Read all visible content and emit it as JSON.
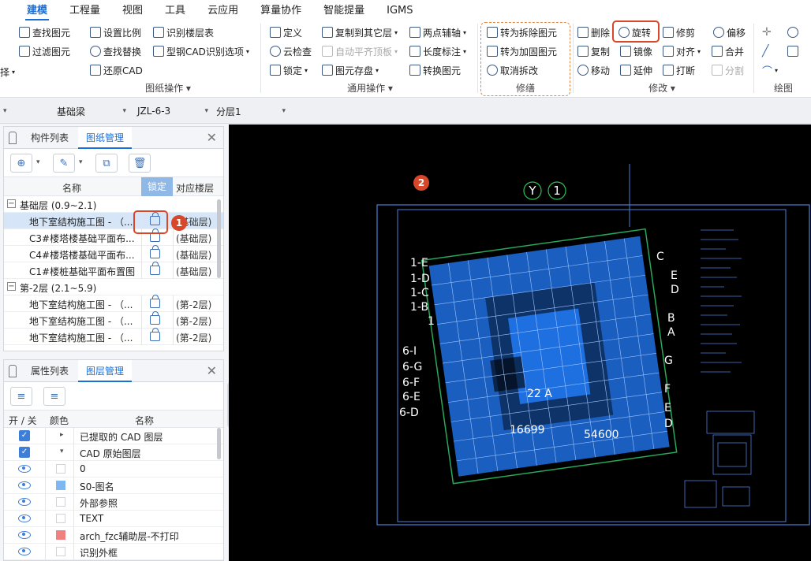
{
  "menu": {
    "tabs": [
      "建模",
      "工程量",
      "视图",
      "工具",
      "云应用",
      "算量协作",
      "智能提量",
      "IGMS"
    ],
    "active": "建模"
  },
  "ribbon": {
    "drawing_ops": {
      "title": "图纸操作",
      "buttons": [
        "查找图元",
        "过滤图元",
        "设置比例",
        "查找替换",
        "还原CAD",
        "识别楼层表",
        "型钢CAD识别选项"
      ],
      "left_cut_label": "择"
    },
    "common_ops": {
      "title": "通用操作",
      "buttons": [
        "定义",
        "云检查",
        "锁定",
        "复制到其它层",
        "自动平齐顶板",
        "图元存盘",
        "两点辅轴",
        "长度标注",
        "转换图元"
      ]
    },
    "repair": {
      "title": "修缮",
      "buttons": [
        "转为拆除图元",
        "转为加固图元",
        "取消拆改"
      ]
    },
    "modify": {
      "title": "修改",
      "buttons": [
        "删除",
        "旋转",
        "修剪",
        "偏移",
        "复制",
        "镜像",
        "对齐",
        "合并",
        "移动",
        "延伸",
        "打断",
        "分割"
      ]
    },
    "draw": {
      "title": "绘图"
    }
  },
  "toolbar2": {
    "component_type": "基础梁",
    "component_name": "JZL-6-3",
    "layer": "分层1"
  },
  "drawing_panel": {
    "tabs": [
      "构件列表",
      "图纸管理"
    ],
    "active_tab": "图纸管理",
    "columns": {
      "name": "名称",
      "lock": "锁定",
      "floor": "对应楼层"
    },
    "groups": [
      {
        "label": "基础层 (0.9~2.1)",
        "items": [
          {
            "name": "地下室结构施工图 - （...",
            "floor": "(基础层)",
            "selected": true
          },
          {
            "name": "C3#楼塔楼基础平面布...",
            "floor": "(基础层)"
          },
          {
            "name": "C4#楼塔楼基础平面布...",
            "floor": "(基础层)"
          },
          {
            "name": "C1#楼桩基础平面布置图",
            "floor": "(基础层)"
          }
        ]
      },
      {
        "label": "第-2层 (2.1~5.9)",
        "items": [
          {
            "name": "地下室结构施工图 - （...",
            "floor": "(第-2层)"
          },
          {
            "name": "地下室结构施工图 - （...",
            "floor": "(第-2层)"
          },
          {
            "name": "地下室结构施工图 - （...",
            "floor": "(第-2层)"
          }
        ]
      }
    ]
  },
  "layer_panel": {
    "tabs": [
      "属性列表",
      "图层管理"
    ],
    "active_tab": "图层管理",
    "columns": {
      "toggle": "开 / 关",
      "color": "颜色",
      "name": "名称"
    },
    "rows": [
      {
        "type": "check",
        "name": "已提取的 CAD 图层",
        "tri": "▸"
      },
      {
        "type": "check",
        "name": "CAD 原始图层",
        "tri": "▾"
      },
      {
        "type": "eye",
        "name": "0",
        "color": "#ffffff"
      },
      {
        "type": "eye",
        "name": "S0-图名",
        "color": "#7fb8f0"
      },
      {
        "type": "eye",
        "name": "外部参照",
        "color": "#ffffff"
      },
      {
        "type": "eye",
        "name": "TEXT",
        "color": "#ffffff"
      },
      {
        "type": "eye",
        "name": "arch_fzc辅助层-不打印",
        "color": "#f07f7f"
      },
      {
        "type": "eye",
        "name": "识别外框",
        "color": "#ffffff"
      }
    ]
  },
  "annotations": {
    "badge1": "1",
    "badge2": "2"
  },
  "canvas_labels": {
    "axis_y": "Y",
    "axis_1": "1",
    "center_a": "22   A",
    "bottom_nums": "16699",
    "bottom_nums2": "54600",
    "right_labels": [
      "C",
      "E",
      "D",
      "B",
      "A",
      "G",
      "F",
      "E",
      "D"
    ],
    "left_labels": [
      "1-E",
      "1-D",
      "1-C",
      "1-B",
      "1",
      "6-I",
      "6-G",
      "6-F",
      "6-E",
      "6-D"
    ]
  }
}
